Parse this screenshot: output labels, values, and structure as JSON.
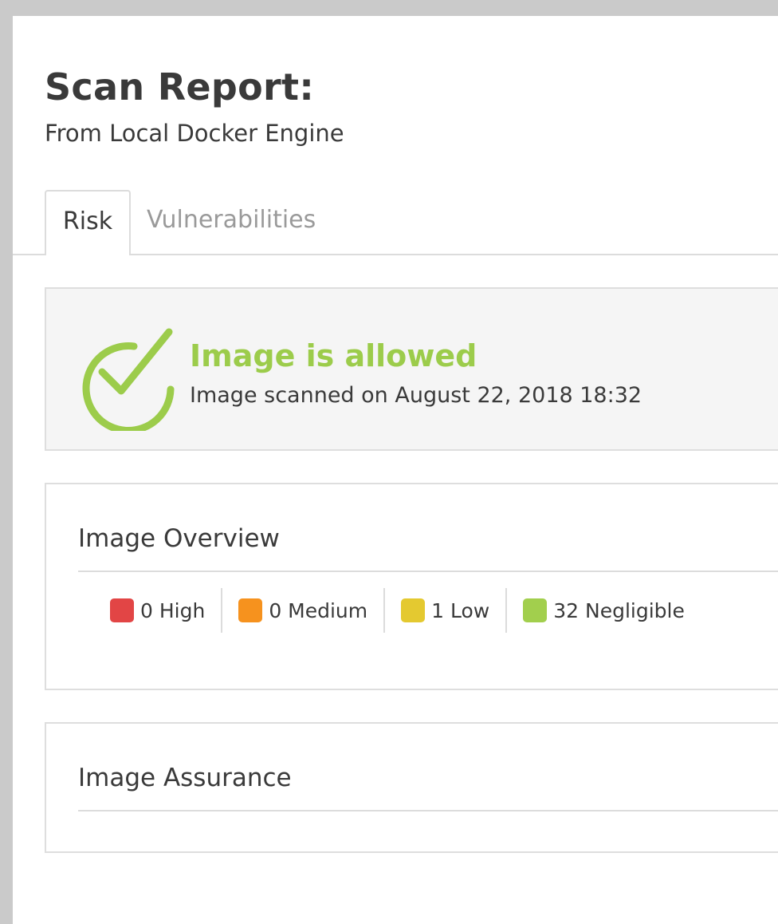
{
  "header": {
    "title": "Scan Report:",
    "subtitle": "From Local Docker Engine"
  },
  "tabs": [
    {
      "label": "Risk",
      "active": true
    },
    {
      "label": "Vulnerabilities",
      "active": false
    }
  ],
  "status": {
    "icon": "check-circle-icon",
    "title": "Image is allowed",
    "scanned": "Image scanned on August 22, 2018 18:32",
    "color": "#9ccc4b"
  },
  "overview": {
    "title": "Image Overview",
    "severities": [
      {
        "label": "0 High",
        "color": "#e24545"
      },
      {
        "label": "0 Medium",
        "color": "#f6921e"
      },
      {
        "label": "1 Low",
        "color": "#e4c930"
      },
      {
        "label": "32 Negligible",
        "color": "#a2cf4d"
      }
    ]
  },
  "assurance": {
    "title": "Image Assurance"
  }
}
